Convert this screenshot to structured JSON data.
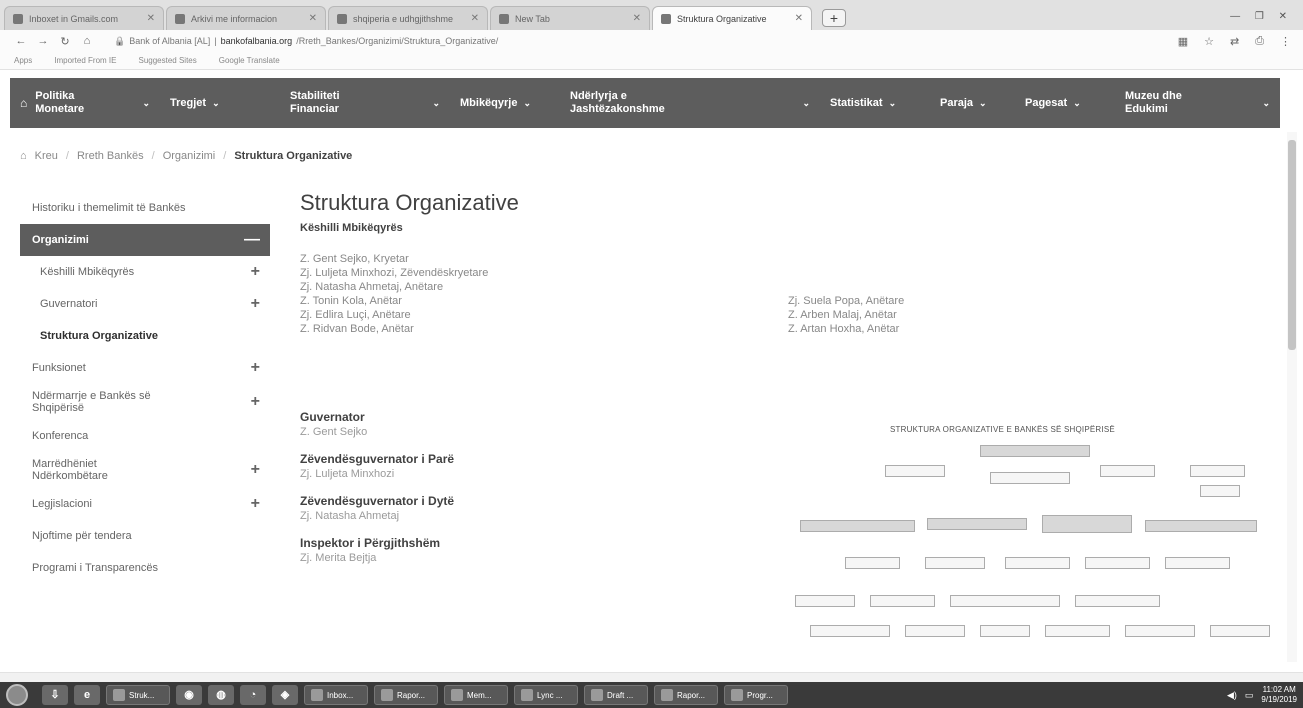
{
  "browser": {
    "tabs": [
      {
        "label": "Inboxet in Gmails.com",
        "active": false
      },
      {
        "label": "Arkivi me informacion",
        "active": false
      },
      {
        "label": "shqiperia e udhgjithshme",
        "active": false
      },
      {
        "label": "New Tab",
        "active": false
      },
      {
        "label": "Struktura Organizative",
        "active": true
      }
    ],
    "new_tab": "+",
    "window_controls": "— ❐ ✕",
    "address": {
      "site": "Bank of Albania [AL]",
      "host": "bankofalbania.org",
      "path": "/Rreth_Bankes/Organizimi/Struktura_Organizative/"
    },
    "bookmarks": [
      "Apps",
      "Imported From IE",
      "Suggested Sites",
      "Google Translate"
    ]
  },
  "nav": {
    "items": [
      {
        "label": "Politika\nMonetare",
        "caret": "⌄"
      },
      {
        "label": "Tregjet",
        "caret": "⌄"
      },
      {
        "label": "Stabiliteti\nFinanciar",
        "caret": "⌄"
      },
      {
        "label": "Mbikëqyrje",
        "caret": "⌄"
      },
      {
        "label": "Ndërlyrja e\nJashtëzakonshme",
        "caret": "⌄"
      },
      {
        "label": "Statistikat",
        "caret": "⌄"
      },
      {
        "label": "Paraja",
        "caret": "⌄"
      },
      {
        "label": "Pagesat",
        "caret": "⌄"
      },
      {
        "label": "Muzeu dhe\nEdukimi",
        "caret": "⌄"
      }
    ]
  },
  "breadcrumb": {
    "home": "Kreu",
    "items": [
      "Rreth Bankës",
      "Organizimi"
    ],
    "current": "Struktura Organizative",
    "separator": "/"
  },
  "sidebar": {
    "items": [
      {
        "label": "Historiku i themelimit të Bankës",
        "kind": "item",
        "toggle": ""
      },
      {
        "label": "Organizimi",
        "kind": "active",
        "toggle": "—"
      },
      {
        "label": "Këshilli Mbikëqyrës",
        "kind": "sub",
        "toggle": "+"
      },
      {
        "label": "Guvernatori",
        "kind": "sub",
        "toggle": "+"
      },
      {
        "label": "Struktura Organizative",
        "kind": "current",
        "toggle": ""
      },
      {
        "label": "Funksionet",
        "kind": "item",
        "toggle": "+"
      },
      {
        "label": "Ndërmarrje e Bankës së Shqipërisë",
        "kind": "item",
        "toggle": "+"
      },
      {
        "label": "Konferenca",
        "kind": "item",
        "toggle": ""
      },
      {
        "label": "Marrëdhëniet Ndërkombëtare",
        "kind": "item",
        "toggle": "+"
      },
      {
        "label": "Legjislacioni",
        "kind": "item",
        "toggle": "+"
      },
      {
        "label": "Njoftime për tendera",
        "kind": "item",
        "toggle": ""
      },
      {
        "label": "Programi i Transparencës",
        "kind": "item",
        "toggle": ""
      }
    ]
  },
  "main": {
    "title": "Struktura Organizative",
    "board_title": "Këshilli Mbikëqyrës",
    "board_left": [
      "Z. Gent Sejko, Kryetar",
      "Zj. Luljeta Minxhozi, Zëvendëskryetare",
      "Zj. Natasha Ahmetaj, Anëtare",
      "Z. Tonin Kola, Anëtar",
      "Zj. Edlira Luçi, Anëtare",
      "Z. Ridvan Bode, Anëtar"
    ],
    "board_right": [
      "Zj. Suela Popa, Anëtare",
      "Z. Arben Malaj, Anëtar",
      "Z. Artan Hoxha, Anëtar"
    ],
    "roles": [
      {
        "title": "Guvernator",
        "name": "Z. Gent Sejko"
      },
      {
        "title": "Zëvendësguvernator i Parë",
        "name": "Zj. Luljeta Minxhozi"
      },
      {
        "title": "Zëvendësguvernator i Dytë",
        "name": "Zj. Natasha Ahmetaj"
      },
      {
        "title": "Inspektor i Përgjithshëm",
        "name": "Zj. Merita Bejtja"
      }
    ],
    "org_chart_title": "STRUKTURA ORGANIZATIVE E BANKËS SË SHQIPËRISË"
  },
  "taskbar": {
    "buttons": [
      "Inbox...",
      "Rapor...",
      "Mem...",
      "Lync ...",
      "Draft ...",
      "Rapor...",
      "Progr..."
    ],
    "first_window": "Struk...",
    "time": "11:02 AM",
    "date": "9/19/2019"
  }
}
